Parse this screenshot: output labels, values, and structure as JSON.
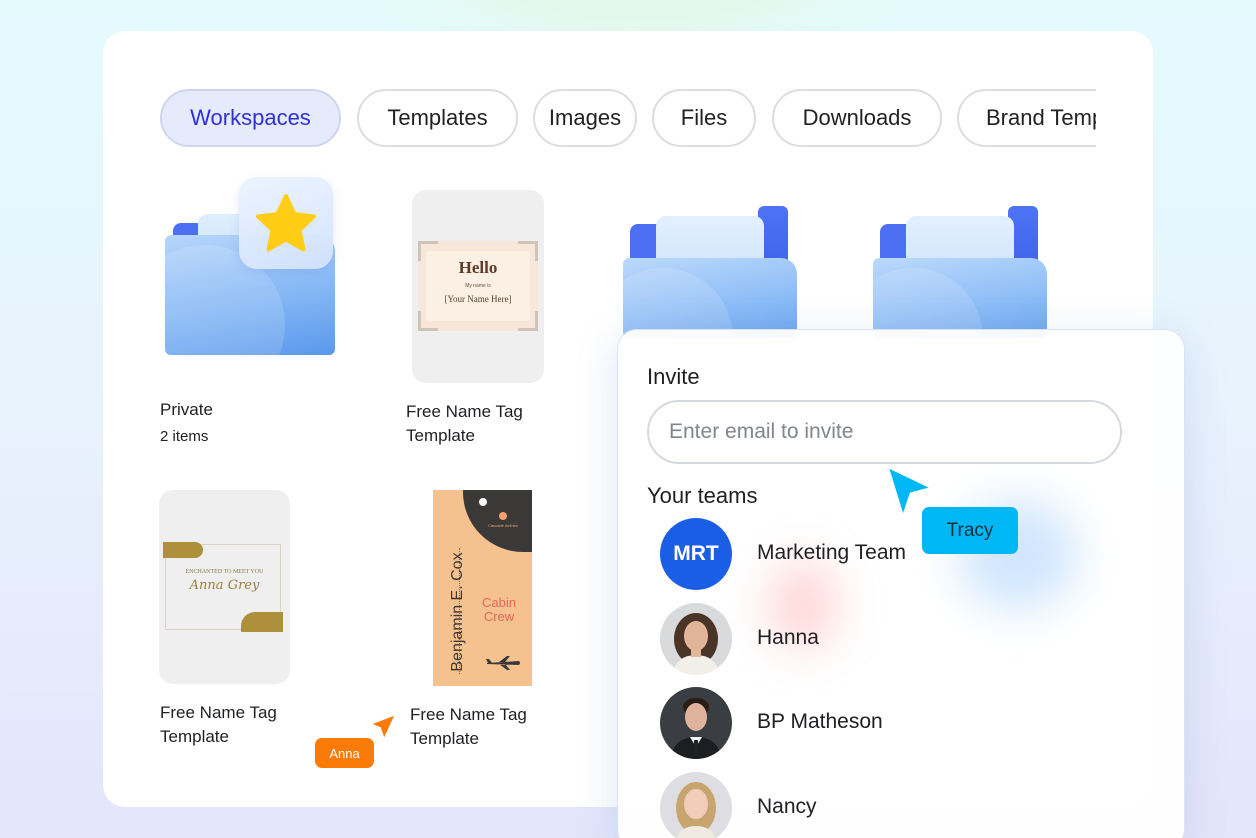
{
  "tabs": [
    {
      "label": "Workspaces",
      "active": true
    },
    {
      "label": "Templates",
      "active": false
    },
    {
      "label": "Images",
      "active": false
    },
    {
      "label": "Files",
      "active": false
    },
    {
      "label": "Downloads",
      "active": false
    },
    {
      "label": "Brand Temp",
      "active": false
    }
  ],
  "items": {
    "private": {
      "title": "Private",
      "count": "2 items",
      "icon": "star-icon"
    },
    "template_hello": {
      "title_line1": "Free Name Tag",
      "title_line2": "Template",
      "thumb_heading": "Hello",
      "thumb_sub": "My name is",
      "thumb_name": "[Your Name Here]"
    },
    "template_anna": {
      "title_line1": "Free Name Tag",
      "title_line2": "Template",
      "thumb_sub": "ENCHANTED TO MEET YOU",
      "thumb_name": "Anna Grey"
    },
    "template_benjamin": {
      "title_line1": "Free Name Tag",
      "title_line2": "Template",
      "thumb_airline": "Cascade Airlines",
      "thumb_name": "Benjamin E. Cox",
      "thumb_role_1": "Cabin",
      "thumb_role_2": "Crew"
    }
  },
  "invite": {
    "title": "Invite",
    "placeholder": "Enter email to invite",
    "teams_title": "Your teams",
    "members": [
      {
        "initials": "MRT",
        "name": "Marketing Team"
      },
      {
        "name": "Hanna"
      },
      {
        "name": "BP Matheson"
      },
      {
        "name": "Nancy"
      }
    ]
  },
  "cursors": {
    "tracy": {
      "label": "Tracy",
      "color": "#00b7f5"
    },
    "anna": {
      "label": "Anna",
      "color": "#fb7b08"
    }
  },
  "colors": {
    "accent": "#2f2fd6",
    "folder_blue": "#4d6ff2",
    "team_avatar": "#1a5ee6",
    "star": "#ffcc16"
  }
}
